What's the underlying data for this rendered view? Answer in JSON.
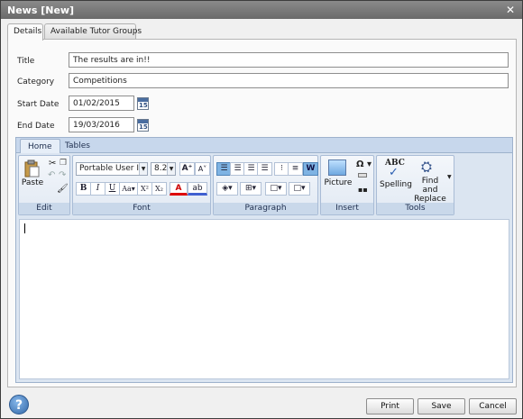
{
  "window": {
    "title": "News [New]",
    "close_glyph": "✕"
  },
  "tabs": [
    "Details",
    "Available Tutor Groups"
  ],
  "form": {
    "title_label": "Title",
    "title_value": "The results are in!!",
    "category_label": "Category",
    "category_value": "Competitions",
    "start_label": "Start Date",
    "start_value": "01/02/2015",
    "end_label": "End Date",
    "end_value": "19/03/2016",
    "calendar_num": "15"
  },
  "ribbon": {
    "tabs": [
      "Home",
      "Tables"
    ],
    "groups": {
      "edit": "Edit",
      "font": "Font",
      "paragraph": "Paragraph",
      "insert": "Insert",
      "tools": "Tools"
    },
    "paste_label": "Paste",
    "font_name": "Portable User In",
    "font_size": "8.2",
    "picture_label": "Picture",
    "spelling_label": "Spelling",
    "find_label_1": "Find and",
    "find_label_2": "Replace",
    "spelling_icon_text": "ABC",
    "glyphs": {
      "bold": "B",
      "italic": "I",
      "underline": "U",
      "case": "Aa▾",
      "super": "X²",
      "sub": "X₂",
      "grow": "A⁺",
      "shrink": "A˅",
      "fontcolor": "A",
      "omega": "Ω ▾",
      "w": "W"
    }
  },
  "footer": {
    "help": "?",
    "print": "Print",
    "save": "Save",
    "cancel": "Cancel"
  }
}
